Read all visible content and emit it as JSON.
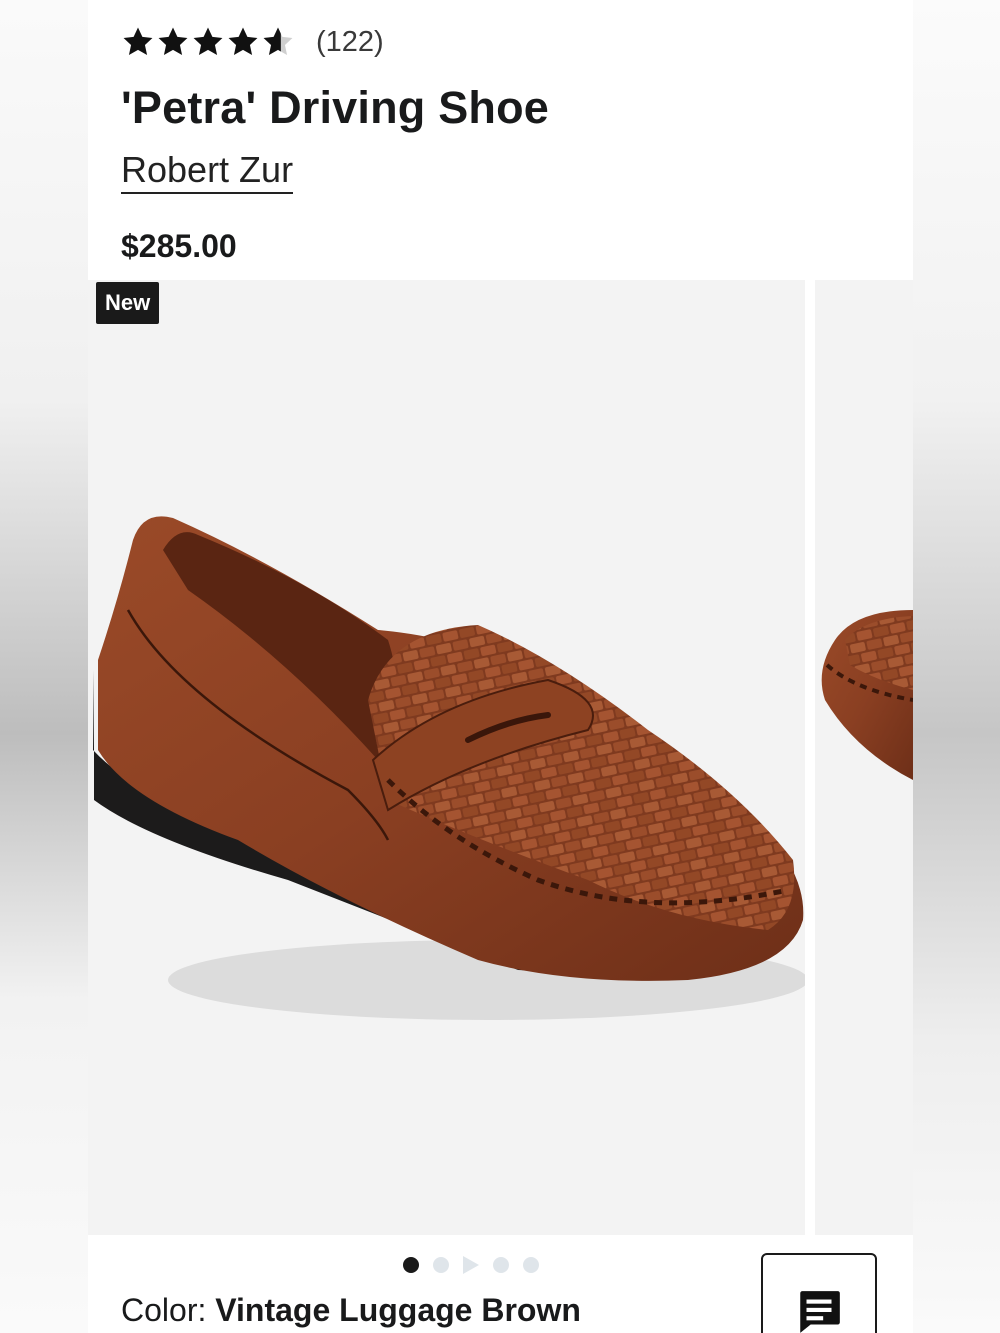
{
  "product": {
    "rating": {
      "stars": 4.5,
      "count_text": "(122)"
    },
    "title": "'Petra' Driving Shoe",
    "brand": "Robert Zur",
    "price": "$285.00"
  },
  "gallery": {
    "badge": "New",
    "images": [
      {
        "alt": "Brown woven leather penny loafer, side view"
      },
      {
        "alt": "Woven leather loafer, toe close-up"
      }
    ],
    "dots": {
      "total": 5,
      "active_index": 0,
      "video_index": 2
    }
  },
  "color": {
    "label": "Color:",
    "value": "Vintage Luggage Brown"
  },
  "chat": {
    "icon": "chat-icon"
  },
  "colors": {
    "text": "#191a1b",
    "badge_bg": "#1a1a1a",
    "dot_inactive": "#dfe5ea",
    "photo_bg": "#f3f3f3",
    "leather": "#8a3f22"
  }
}
